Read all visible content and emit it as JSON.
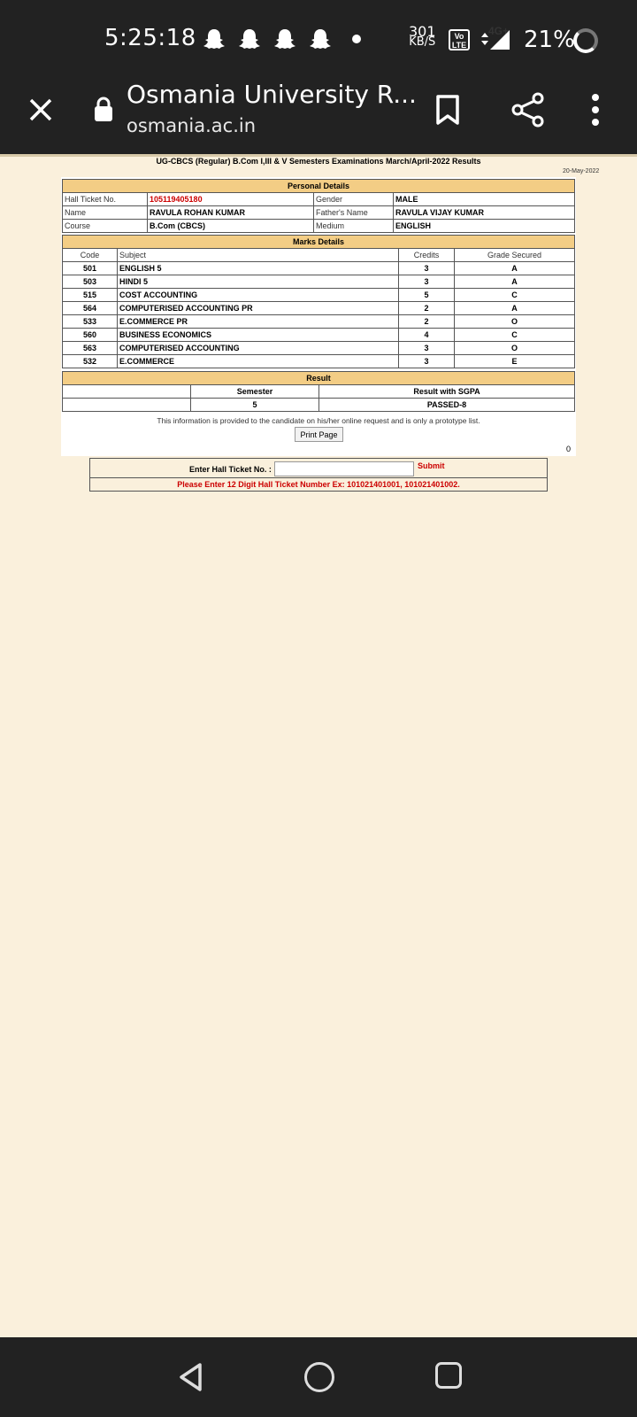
{
  "statusbar": {
    "time": "5:25:18",
    "speed_value": "301",
    "speed_unit": "KB/S",
    "volte": "Vo LTE",
    "network": "4G+",
    "battery": "21%"
  },
  "toolbar": {
    "title": "Osmania University R...",
    "url": "osmania.ac.in"
  },
  "page": {
    "title": "UG-CBCS (Regular) B.Com I,III & V Semesters Examinations March/April-2022 Results",
    "date": "20-May-2022",
    "personal": {
      "header": "Personal Details",
      "hall_ticket_label": "Hall Ticket No.",
      "hall_ticket_value": "105119405180",
      "gender_label": "Gender",
      "gender_value": "MALE",
      "name_label": "Name",
      "name_value": "RAVULA ROHAN KUMAR",
      "father_label": "Father's Name",
      "father_value": "RAVULA VIJAY KUMAR",
      "course_label": "Course",
      "course_value": "B.Com (CBCS)",
      "medium_label": "Medium",
      "medium_value": "ENGLISH"
    },
    "marks": {
      "header": "Marks Details",
      "columns": [
        "Code",
        "Subject",
        "Credits",
        "Grade Secured"
      ],
      "rows": [
        {
          "code": "501",
          "subject": "ENGLISH 5",
          "credits": "3",
          "grade": "A"
        },
        {
          "code": "503",
          "subject": "HINDI 5",
          "credits": "3",
          "grade": "A"
        },
        {
          "code": "515",
          "subject": "COST ACCOUNTING",
          "credits": "5",
          "grade": "C"
        },
        {
          "code": "564",
          "subject": "COMPUTERISED ACCOUNTING PR",
          "credits": "2",
          "grade": "A"
        },
        {
          "code": "533",
          "subject": "E.COMMERCE PR",
          "credits": "2",
          "grade": "O"
        },
        {
          "code": "560",
          "subject": "BUSINESS ECONOMICS",
          "credits": "4",
          "grade": "C"
        },
        {
          "code": "563",
          "subject": "COMPUTERISED ACCOUNTING",
          "credits": "3",
          "grade": "O"
        },
        {
          "code": "532",
          "subject": "E.COMMERCE",
          "credits": "3",
          "grade": "E"
        }
      ]
    },
    "result": {
      "header": "Result",
      "semester_label": "Semester",
      "sgpa_label": "Result with SGPA",
      "semester_value": "5",
      "sgpa_value": "PASSED-8"
    },
    "note": "This information is provided to the candidate on his/her online request and is only a prototype list.",
    "print_label": "Print Page",
    "counter": "0",
    "form": {
      "label": "Enter Hall Ticket No. :",
      "input_value": "",
      "submit_label": "Submit",
      "help": "Please Enter 12 Digit Hall Ticket Number Ex: 101021401001, 101021401002."
    }
  },
  "icons": {
    "notifications": [
      "snapchat-icon",
      "snapchat-icon",
      "snapchat-icon",
      "snapchat-icon"
    ],
    "toolbar": [
      "close-icon",
      "lock-icon",
      "bookmark-icon",
      "share-icon",
      "more-vert-icon"
    ],
    "nav": [
      "back-icon",
      "home-icon",
      "recents-icon"
    ]
  }
}
